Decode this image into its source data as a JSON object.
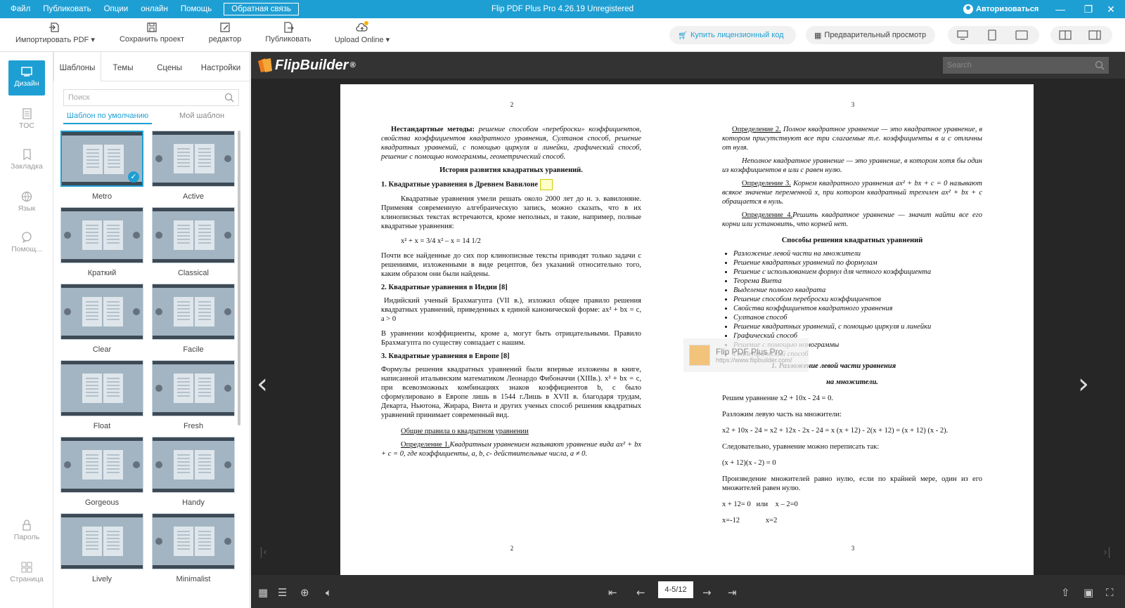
{
  "menu": [
    "Файл",
    "Публиковать",
    "Опции",
    "онлайн",
    "Помощь"
  ],
  "feedback": "Обратная связь",
  "app_title": "Flip PDF Plus Pro 4.26.19 Unregistered",
  "login": "Авторизоваться",
  "toolbar": {
    "import": "Импортировать PDF ▾",
    "save": "Сохранить проект",
    "editor": "редактор",
    "publish": "Публиковать",
    "upload": "Upload Online ▾",
    "buy": "Купить лицензионный код",
    "preview": "Предварительный просмотр"
  },
  "nav": {
    "design": "Дизайн",
    "toc": "TOC",
    "bookmark": "Закладка",
    "lang": "Язык",
    "help": "Помощ...",
    "password": "Пароль",
    "page": "Страница"
  },
  "tabs": [
    "Шаблоны",
    "Темы",
    "Сцены",
    "Настройки"
  ],
  "search_placeholder": "Поиск",
  "subtabs": {
    "default": "Шаблон по умолчанию",
    "mine": "Мой шаблон"
  },
  "templates": [
    "Metro",
    "Active",
    "Краткий",
    "Classical",
    "Clear",
    "Facile",
    "Float",
    "Fresh",
    "Gorgeous",
    "Handy",
    "Lively",
    "Minimalist"
  ],
  "viewer": {
    "logo": "FlipBuilder",
    "search": "Search",
    "page_indicator": "4-5/12"
  },
  "watermark": {
    "title": "Flip PDF Plus Pro",
    "url": "https://www.flipbuilder.com/"
  },
  "left_page": {
    "num_top": "2",
    "num_bottom": "2",
    "intro_bold": "Нестандартные методы:",
    "intro": "решение способом «переброски» коэффициентов, свойства коэффициентов квадратного уравнения, Султанов способ, решение квадратных уравнений, с помощью циркуля и линейки, графический способ, решение с помощью номограммы, геометрический способ.",
    "h_history": "История развития квадратных уравнений.",
    "h1": "1. Квадратные уравнения в Древнем Вавилоне",
    "p1": "Квадратные уравнения умели решать около 2000 лет до н. э. вавилоняне. Применяя современную алгебраическую запись, можно сказать, что в их клинописных текстах встречаются, кроме неполных, и такие, например, полные квадратные уравнения:",
    "formula": "x² + x = 3/4      x² – x = 14 1/2",
    "p2": "Почти все найденные до сих пор клинописные тексты приводят только задачи с решениями, изложенными в виде рецептов, без указаний относительно того, каким образом они были найдены.",
    "h2": "2. Квадратные уравнения в Индии [8]",
    "p3": "Индийский ученый Брахмагупта (VII в.), изложил общее правило решения квадратных уравнений, приведенных к единой канонической форме: ax² + bx = c, a > 0",
    "p4": "В уравнении коэффициенты, кроме а, могут быть отрицательными. Правило Брахмагупта по существу совпадает с нашим.",
    "h3": "3. Квадратные уравнения в Европе [8]",
    "p5": "Формулы решения квадратных уравнений были впервые изложены в книге, написанной итальянским математиком Леонардо Фибоначчи (XIIIв.). x² + bx = c, при всевозможных комбинациях знаков коэффициентов b, с было сформулировано в Европе лишь в 1544 г.Лишь в XVII в. благодаря трудам, Декарта, Ньютона, Жирара, Виета и других ученых способ решения квадратных уравнений принимает современный вид.",
    "h_rules": "Общие правила о квадратном уравнении",
    "def1_label": "Определение 1.",
    "def1": "Квадратным уравнением называют уравнение вида ax² + bx + c = 0, где коэффициенты, a, b, c- действительные числа, a ≠ 0."
  },
  "right_page": {
    "num_top": "3",
    "num_bottom": "3",
    "def2_label": "Определение 2.",
    "def2": "Полное квадратное уравнение — это квадратное уравнение, в котором присутствуют все три слагаемые т.е. коэффициенты в и с отличны от нуля.",
    "incomplete": "Неполное квадратное уравнение — это уравнение, в котором хотя бы один из коэффициентов в или с равен нулю.",
    "def3_label": "Определение 3.",
    "def3": "Корнем квадратного уравнения ax² + bx + c = 0 называют всякое значение переменной x, при котором квадратный трехчлен ax² + bx + c обращается в нуль.",
    "def4_label": "Определение 4.",
    "def4": "Решить квадратное уравнение — значит найти все его корни или установить, что корней нет.",
    "h_methods": "Способы решения квадратных уравнений",
    "methods": [
      "Разложение левой части на множители",
      "Решение квадратных уравнений по формулам",
      "Решение с использованием формул для четного коэффициента",
      "Теорема Виета",
      "Выделение полного квадрата",
      "Решение способом переброски коэффициентов",
      "Свойства коэффициентов квадратного уравнения",
      "Султанов способ",
      "Решение квадратных уравнений, с помощью циркуля и линейки",
      "Графический способ",
      "Решение с помощью номограммы",
      "Геометрический способ"
    ],
    "h_factor1": "1.          Разложение левой части уравнения",
    "h_factor2": "на множители.",
    "s1": "Решим уравнение x2 + 10x - 24 = 0.",
    "s2": "Разложим левую часть на множители:",
    "s3": "x2 + 10x - 24 = x2 + 12x - 2x - 24 = x (x + 12) - 2(x + 12) = (x + 12) (x - 2).",
    "s4": "Следовательно, уравнение можно переписать так:",
    "s5": "(x + 12)(x - 2) = 0",
    "s6": "Произведение множителей равно нулю, если по крайней мере, один из его множителей равен нулю.",
    "s7": "x + 12= 0   или    x – 2=0",
    "s8": "x=-12              x=2"
  },
  "colors": {
    "accent": "#1e9fd3",
    "viewer_bg": "#262626"
  }
}
